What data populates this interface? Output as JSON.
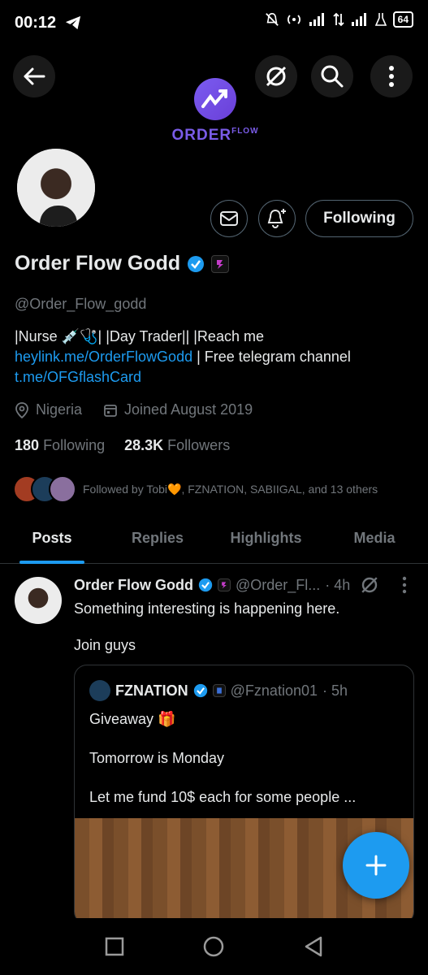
{
  "status_bar": {
    "time": "00:12",
    "battery": "64"
  },
  "banner": {
    "logo_main": "ORDER",
    "logo_sub": "FLOW"
  },
  "profile": {
    "display_name": "Order Flow Godd",
    "handle": "@Order_Flow_godd",
    "bio_part1": "|Nurse 💉🩺| |Day Trader|| |Reach me ",
    "bio_link1": "heylink.me/OrderFlowGodd",
    "bio_part2": " | Free telegram channel ",
    "bio_link2": "t.me/OFGflashCard",
    "location": "Nigeria",
    "joined": "Joined August 2019",
    "following_count": "180",
    "following_label": "Following",
    "followers_count": "28.3K",
    "followers_label": "Followers",
    "followed_by": "Followed by Tobi🧡, FZNATION, SABIIGAL, and 13 others"
  },
  "buttons": {
    "following": "Following"
  },
  "tabs": [
    {
      "label": "Posts"
    },
    {
      "label": "Replies"
    },
    {
      "label": "Highlights"
    },
    {
      "label": "Media"
    }
  ],
  "post": {
    "name": "Order Flow Godd",
    "handle": "@Order_Fl...",
    "time": "· 4h",
    "text1": "Something interesting is happening here.",
    "text2": "Join guys",
    "quote": {
      "name": "FZNATION",
      "handle": "@Fznation01",
      "time": "· 5h",
      "line1": "Giveaway 🎁",
      "line2": "Tomorrow is Monday",
      "line3": "Let me fund 10$  each for some people ..."
    }
  },
  "colors": {
    "accent": "#1d9bf0",
    "muted": "#71767b",
    "text": "#e7e9ea",
    "brand": "#7a5ce8"
  }
}
